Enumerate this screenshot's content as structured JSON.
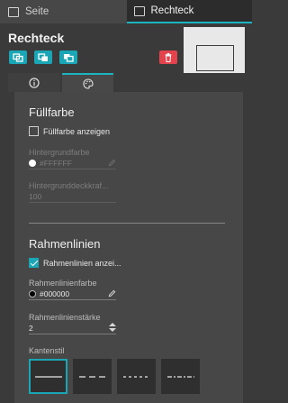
{
  "top_tabs": [
    {
      "label": "Seite",
      "icon": "page-icon",
      "active": false
    },
    {
      "label": "Rechteck",
      "icon": "rectangle-icon",
      "active": true
    }
  ],
  "header": {
    "title": "Rechteck",
    "actions": [
      {
        "icon": "duplicate-icon"
      },
      {
        "icon": "bring-to-front-icon"
      },
      {
        "icon": "send-to-back-icon"
      }
    ],
    "delete_icon": "trash-icon"
  },
  "section_tabs": [
    {
      "icon": "info-icon",
      "active": false
    },
    {
      "icon": "palette-icon",
      "active": true
    }
  ],
  "fill": {
    "heading": "Füllfarbe",
    "show_fill_label": "Füllfarbe anzeigen",
    "show_fill_checked": false,
    "bg_color_label": "Hintergrundfarbe",
    "bg_color_value": "#FFFFFF",
    "bg_opacity_label": "Hintergrunddeckkraf...",
    "bg_opacity_value": "100"
  },
  "border": {
    "heading": "Rahmenlinien",
    "show_border_label": "Rahmenlinien anzei...",
    "show_border_checked": true,
    "border_color_label": "Rahmenlinienfarbe",
    "border_color_value": "#000000",
    "border_width_label": "Rahmenlinienstärke",
    "border_width_value": "2",
    "edge_style_label": "Kantenstil",
    "edge_styles": [
      "solid",
      "dashed",
      "dotted",
      "dash-dot"
    ],
    "edge_style_selected": "solid"
  },
  "colors": {
    "accent": "#1aa6b5",
    "danger": "#e2434d",
    "panel": "#474747",
    "background": "#3a3a3a"
  }
}
